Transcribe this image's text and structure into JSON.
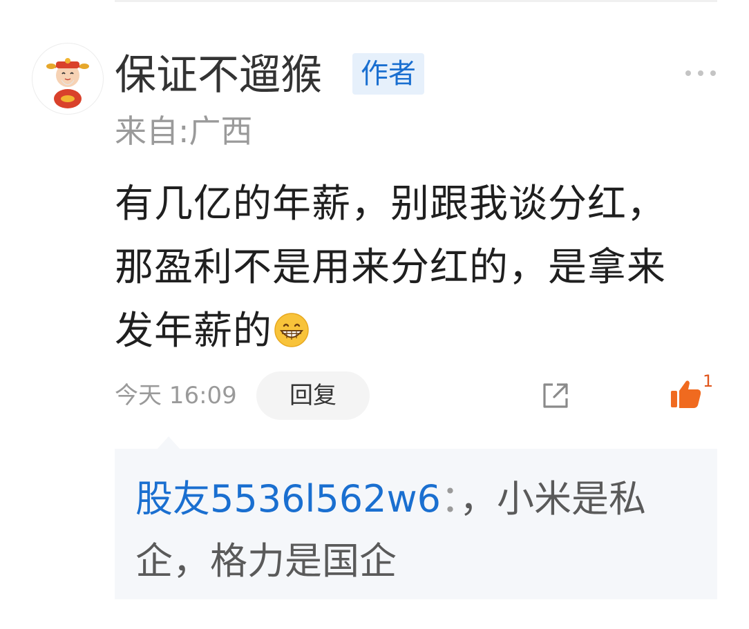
{
  "comment": {
    "username": "保证不遛猴",
    "author_badge": "作者",
    "location": "来自:广西",
    "content": "有几亿的年薪，别跟我谈分红，那盈利不是用来分红的，是拿来发年薪的",
    "emoji": "grinning-face-emoji",
    "timestamp": "今天 16:09",
    "reply_label": "回复",
    "like_count": "1",
    "more_icon": "more-dots-icon",
    "share_icon": "share-icon",
    "like_icon": "thumbs-up-icon"
  },
  "reply": {
    "username": "股友5536l562w6",
    "separator": "：",
    "text": "，小米是私企，格力是国企"
  },
  "colors": {
    "accent_blue": "#1a6fd0",
    "badge_bg": "#e6f0fb",
    "like_orange": "#f06a1f",
    "secondary_text": "#9a9a9a",
    "reply_bg": "#f5f7fa"
  }
}
